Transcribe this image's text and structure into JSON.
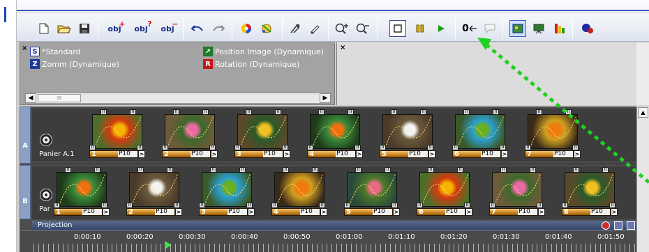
{
  "toolbar": {
    "buttons": [
      {
        "name": "new-icon",
        "x": 36
      },
      {
        "name": "open-folder-icon",
        "x": 66
      },
      {
        "name": "save-icon",
        "x": 96
      }
    ],
    "obj_add": "obj",
    "obj_query": "obj",
    "obj_remove": "obj",
    "zero_counter": "0",
    "colors": {
      "play": "#19a019",
      "pause": "#d4b000",
      "accent": "#1a3ea8"
    }
  },
  "properties": {
    "items": [
      {
        "label": "*Standard"
      },
      {
        "label": "Zomm (Dynamique)"
      },
      {
        "label": "Position Image (Dynamique)"
      },
      {
        "label": "Rotation (Dynamique)"
      }
    ],
    "scroll_thumb": "III"
  },
  "timeline": {
    "lane_a_label": "A",
    "lane_b_label": "B",
    "lane_a_name": "Panier A.1",
    "lane_b_name": "Par",
    "clip_prefix": "P10",
    "lane_a_clips": [
      "1",
      "2",
      "3",
      "4",
      "5",
      "6",
      "7"
    ],
    "lane_b_clips": [
      "1",
      "2",
      "3",
      "4",
      "5",
      "6",
      "7",
      "8"
    ],
    "projection_label": "Projection",
    "ruler_times": [
      "0:00:10",
      "0:00:20",
      "0:00:30",
      "0:00:40",
      "0:00:50",
      "0:01:00",
      "0:01:10",
      "0:01:20",
      "0:01:30",
      "0:01:40",
      "0:01:50"
    ]
  }
}
